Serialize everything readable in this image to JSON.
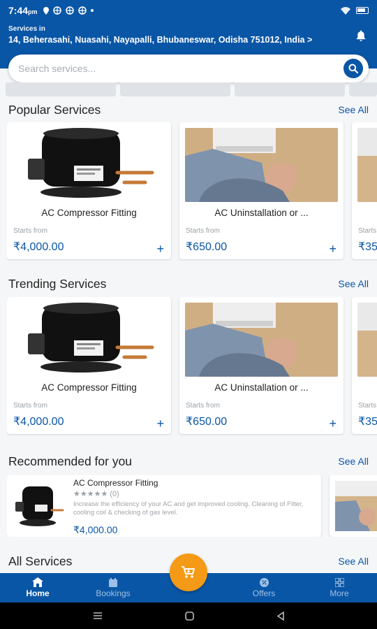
{
  "status_bar": {
    "time": "7:44",
    "ampm": "pm"
  },
  "header": {
    "location_label": "Services in",
    "location_address": "14, Beherasahi, Nuasahi, Nayapalli, Bhubaneswar, Odisha 751012, India >"
  },
  "search": {
    "placeholder": "Search services..."
  },
  "popular": {
    "title": "Popular Services",
    "see_all": "See All",
    "cards": [
      {
        "name": "AC Compressor Fitting",
        "starts": "Starts from",
        "price": "₹4,000.00",
        "plus": "+"
      },
      {
        "name": "AC Uninstallation or ...",
        "starts": "Starts from",
        "price": "₹650.00",
        "plus": "+"
      },
      {
        "name": "",
        "starts": "Starts",
        "price": "₹35",
        "plus": ""
      }
    ]
  },
  "trending": {
    "title": "Trending Services",
    "see_all": "See All",
    "cards": [
      {
        "name": "AC Compressor Fitting",
        "starts": "Starts from",
        "price": "₹4,000.00",
        "plus": "+"
      },
      {
        "name": "AC Uninstallation or ...",
        "starts": "Starts from",
        "price": "₹650.00",
        "plus": "+"
      },
      {
        "name": "",
        "starts": "Starts",
        "price": "₹35",
        "plus": ""
      }
    ]
  },
  "recommended": {
    "title": "Recommended for you",
    "see_all": "See All",
    "item": {
      "name": "AC Compressor Fitting",
      "stars": "★★★★★",
      "rating_count": "(0)",
      "description": "Increase the efficiency of your AC and get improved cooling. Cleaning of Filter, cooling coil & checking of gas level.",
      "price": "₹4,000.00"
    }
  },
  "all_services": {
    "title": "All Services",
    "see_all": "See All"
  },
  "bottom_nav": {
    "home": "Home",
    "bookings": "Bookings",
    "offers": "Offers",
    "more": "More"
  },
  "colors": {
    "primary": "#0a56a6",
    "accent": "#f59a16"
  }
}
